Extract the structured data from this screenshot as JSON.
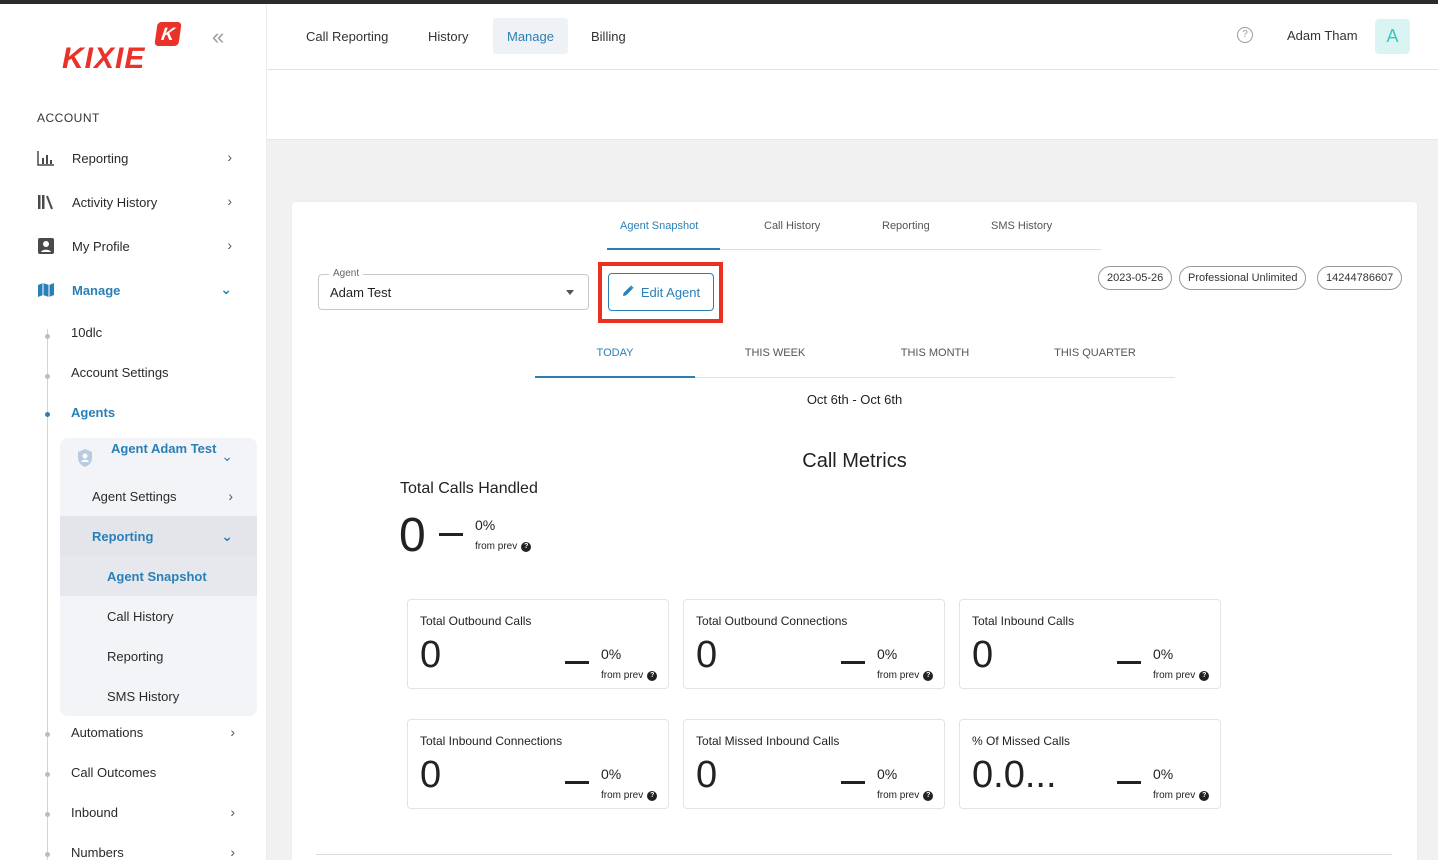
{
  "brand": {
    "logo_text": "KIXIE",
    "badge_letter": "K"
  },
  "sidebar": {
    "section_label": "ACCOUNT",
    "items": [
      {
        "label": "Reporting",
        "icon": "bar-chart-icon"
      },
      {
        "label": "Activity History",
        "icon": "books-icon"
      },
      {
        "label": "My Profile",
        "icon": "id-card-icon"
      },
      {
        "label": "Manage",
        "icon": "map-icon"
      }
    ],
    "manage_children": [
      {
        "label": "10dlc"
      },
      {
        "label": "Account Settings"
      },
      {
        "label": "Agents"
      }
    ],
    "agent_group": {
      "title": "Agent Adam Test",
      "items": [
        {
          "label": "Agent Settings"
        },
        {
          "label": "Reporting"
        },
        {
          "label": "Agent Snapshot"
        },
        {
          "label": "Call History"
        },
        {
          "label": "Reporting"
        },
        {
          "label": "SMS History"
        }
      ]
    },
    "after_children": [
      {
        "label": "Automations"
      },
      {
        "label": "Call Outcomes"
      },
      {
        "label": "Inbound"
      },
      {
        "label": "Numbers"
      }
    ]
  },
  "topnav": {
    "tabs": [
      "Call Reporting",
      "History",
      "Manage",
      "Billing"
    ],
    "active_tab": "Manage",
    "user_name": "Adam Tham",
    "avatar_letter": "A"
  },
  "card": {
    "tabs": [
      "Agent Snapshot",
      "Call History",
      "Reporting",
      "SMS History"
    ],
    "agent_select": {
      "label": "Agent",
      "value": "Adam Test"
    },
    "edit_button": "Edit Agent",
    "chips": [
      "2023-05-26",
      "Professional Unlimited",
      "14244786607"
    ],
    "period_tabs": [
      "TODAY",
      "THIS WEEK",
      "THIS MONTH",
      "THIS QUARTER"
    ],
    "date_range": "Oct 6th - Oct 6th",
    "section_title": "Call Metrics",
    "total_calls": {
      "label": "Total Calls Handled",
      "value": "0",
      "pct": "0%",
      "prev": "from prev"
    },
    "metrics": [
      {
        "label": "Total Outbound Calls",
        "value": "0",
        "pct": "0%",
        "prev": "from prev"
      },
      {
        "label": "Total Outbound Connections",
        "value": "0",
        "pct": "0%",
        "prev": "from prev"
      },
      {
        "label": "Total Inbound Calls",
        "value": "0",
        "pct": "0%",
        "prev": "from prev"
      },
      {
        "label": "Total Inbound Connections",
        "value": "0",
        "pct": "0%",
        "prev": "from prev"
      },
      {
        "label": "Total Missed Inbound Calls",
        "value": "0",
        "pct": "0%",
        "prev": "from prev"
      },
      {
        "label": "% Of Missed Calls",
        "value": "0.0...",
        "pct": "0%",
        "prev": "from prev"
      }
    ]
  },
  "colors": {
    "accent": "#2a7fb6",
    "brand_red": "#e8322a",
    "highlight_outline": "#e8321f"
  }
}
